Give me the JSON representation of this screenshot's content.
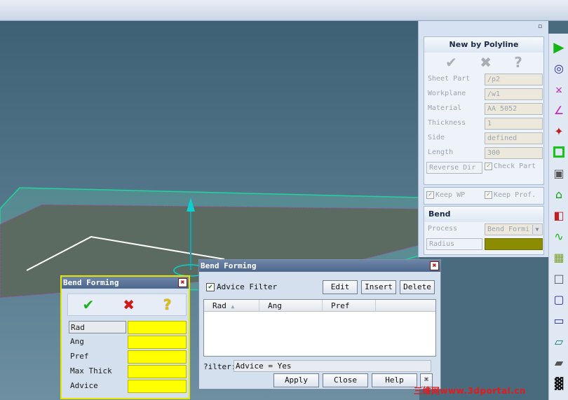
{
  "right_panel": {
    "title": "New by Polyline",
    "fields": [
      {
        "label": "Sheet Part",
        "value": "/p2"
      },
      {
        "label": "Workplane",
        "value": "/w1"
      },
      {
        "label": "Material",
        "value": "AA 5052"
      },
      {
        "label": "Thickness",
        "value": "1"
      },
      {
        "label": "Side",
        "value": "defined"
      },
      {
        "label": "Length",
        "value": "300"
      }
    ],
    "reverse_dir": "Reverse Dir",
    "check_part": "Check Part",
    "keep_wp": "Keep WP",
    "keep_prof": "Keep Prof.",
    "bend_section": {
      "title": "Bend",
      "process_label": "Process",
      "process_value": "Bend Formi",
      "radius_label": "Radius"
    }
  },
  "small_dialog": {
    "title": "Bend Forming",
    "rows": [
      "Rad",
      "Ang",
      "Pref",
      "Max Thick",
      "Advice"
    ]
  },
  "big_dialog": {
    "title": "Bend Forming",
    "advice_filter_label": "Advice Filter",
    "buttons": {
      "edit": "Edit",
      "insert": "Insert",
      "delete": "Delete",
      "apply": "Apply",
      "close": "Close",
      "help": "Help"
    },
    "columns": [
      "Rad",
      "Ang",
      "Pref"
    ],
    "filter_label": "?ilter:",
    "filter_value": "Advice = Yes"
  },
  "watermark": "三维网www.3dportal.cn",
  "colors": {
    "accent_yellow": "#ffff00",
    "olive": "#8c8c00",
    "sheet": "#5f6f66",
    "edge": "#1ec998"
  }
}
